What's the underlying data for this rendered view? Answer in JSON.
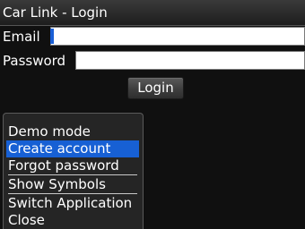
{
  "app": {
    "title": "Car Link - Login"
  },
  "form": {
    "email_label": "Email",
    "email_value": "",
    "password_label": "Password",
    "password_value": "",
    "login_label": "Login"
  },
  "menu": {
    "items": [
      {
        "label": "Demo mode",
        "selected": false
      },
      {
        "label": "Create account",
        "selected": true
      },
      {
        "label": "Forgot password",
        "selected": false
      },
      {
        "label": "Show Symbols",
        "selected": false
      },
      {
        "label": "Switch Application",
        "selected": false
      },
      {
        "label": "Close",
        "selected": false
      }
    ]
  },
  "colors": {
    "selection": "#1760d4",
    "cursor": "#1a5fd6",
    "background": "#101010"
  }
}
